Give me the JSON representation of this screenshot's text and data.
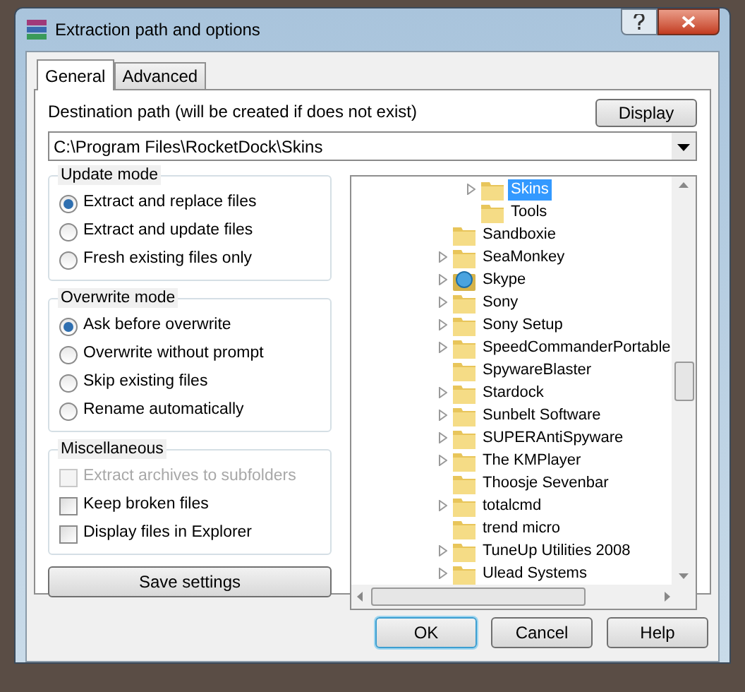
{
  "window": {
    "title": "Extraction path and options"
  },
  "tabs": [
    {
      "label": "General",
      "selected": true
    },
    {
      "label": "Advanced",
      "selected": false
    }
  ],
  "destination": {
    "label": "Destination path (will be created if does not exist)",
    "value": "C:\\Program Files\\RocketDock\\Skins",
    "display_button": "Display"
  },
  "update_mode": {
    "title": "Update mode",
    "options": [
      {
        "label": "Extract and replace files",
        "selected": true
      },
      {
        "label": "Extract and update files",
        "selected": false
      },
      {
        "label": "Fresh existing files only",
        "selected": false
      }
    ]
  },
  "overwrite_mode": {
    "title": "Overwrite mode",
    "options": [
      {
        "label": "Ask before overwrite",
        "selected": true
      },
      {
        "label": "Overwrite without prompt",
        "selected": false
      },
      {
        "label": "Skip existing files",
        "selected": false
      },
      {
        "label": "Rename automatically",
        "selected": false
      }
    ]
  },
  "miscellaneous": {
    "title": "Miscellaneous",
    "options": [
      {
        "label": "Extract archives to subfolders",
        "checked": false,
        "disabled": true
      },
      {
        "label": "Keep broken files",
        "checked": false,
        "disabled": false
      },
      {
        "label": "Display files in Explorer",
        "checked": false,
        "disabled": false
      }
    ]
  },
  "save_button": "Save settings",
  "folder_tree": {
    "nested_items": [
      {
        "label": "Skins",
        "expandable": true,
        "selected": true,
        "kind": "folder"
      },
      {
        "label": "Tools",
        "expandable": false,
        "selected": false,
        "kind": "folder"
      }
    ],
    "items": [
      {
        "label": "Sandboxie",
        "expandable": false,
        "selected": false,
        "kind": "folder"
      },
      {
        "label": "SeaMonkey",
        "expandable": true,
        "selected": false,
        "kind": "folder"
      },
      {
        "label": "Skype",
        "expandable": true,
        "selected": false,
        "kind": "app"
      },
      {
        "label": "Sony",
        "expandable": true,
        "selected": false,
        "kind": "folder"
      },
      {
        "label": "Sony Setup",
        "expandable": true,
        "selected": false,
        "kind": "folder"
      },
      {
        "label": "SpeedCommanderPortable",
        "expandable": true,
        "selected": false,
        "kind": "folder"
      },
      {
        "label": "SpywareBlaster",
        "expandable": false,
        "selected": false,
        "kind": "folder"
      },
      {
        "label": "Stardock",
        "expandable": true,
        "selected": false,
        "kind": "folder"
      },
      {
        "label": "Sunbelt Software",
        "expandable": true,
        "selected": false,
        "kind": "folder"
      },
      {
        "label": "SUPERAntiSpyware",
        "expandable": true,
        "selected": false,
        "kind": "folder"
      },
      {
        "label": "The KMPlayer",
        "expandable": true,
        "selected": false,
        "kind": "folder"
      },
      {
        "label": "Thoosje Sevenbar",
        "expandable": false,
        "selected": false,
        "kind": "folder"
      },
      {
        "label": "totalcmd",
        "expandable": true,
        "selected": false,
        "kind": "folder"
      },
      {
        "label": "trend micro",
        "expandable": false,
        "selected": false,
        "kind": "folder"
      },
      {
        "label": "TuneUp Utilities 2008",
        "expandable": true,
        "selected": false,
        "kind": "folder"
      },
      {
        "label": "Ulead Systems",
        "expandable": true,
        "selected": false,
        "kind": "folder"
      }
    ]
  },
  "buttons": [
    {
      "label": "OK",
      "default": true
    },
    {
      "label": "Cancel",
      "default": false
    },
    {
      "label": "Help",
      "default": false
    }
  ]
}
